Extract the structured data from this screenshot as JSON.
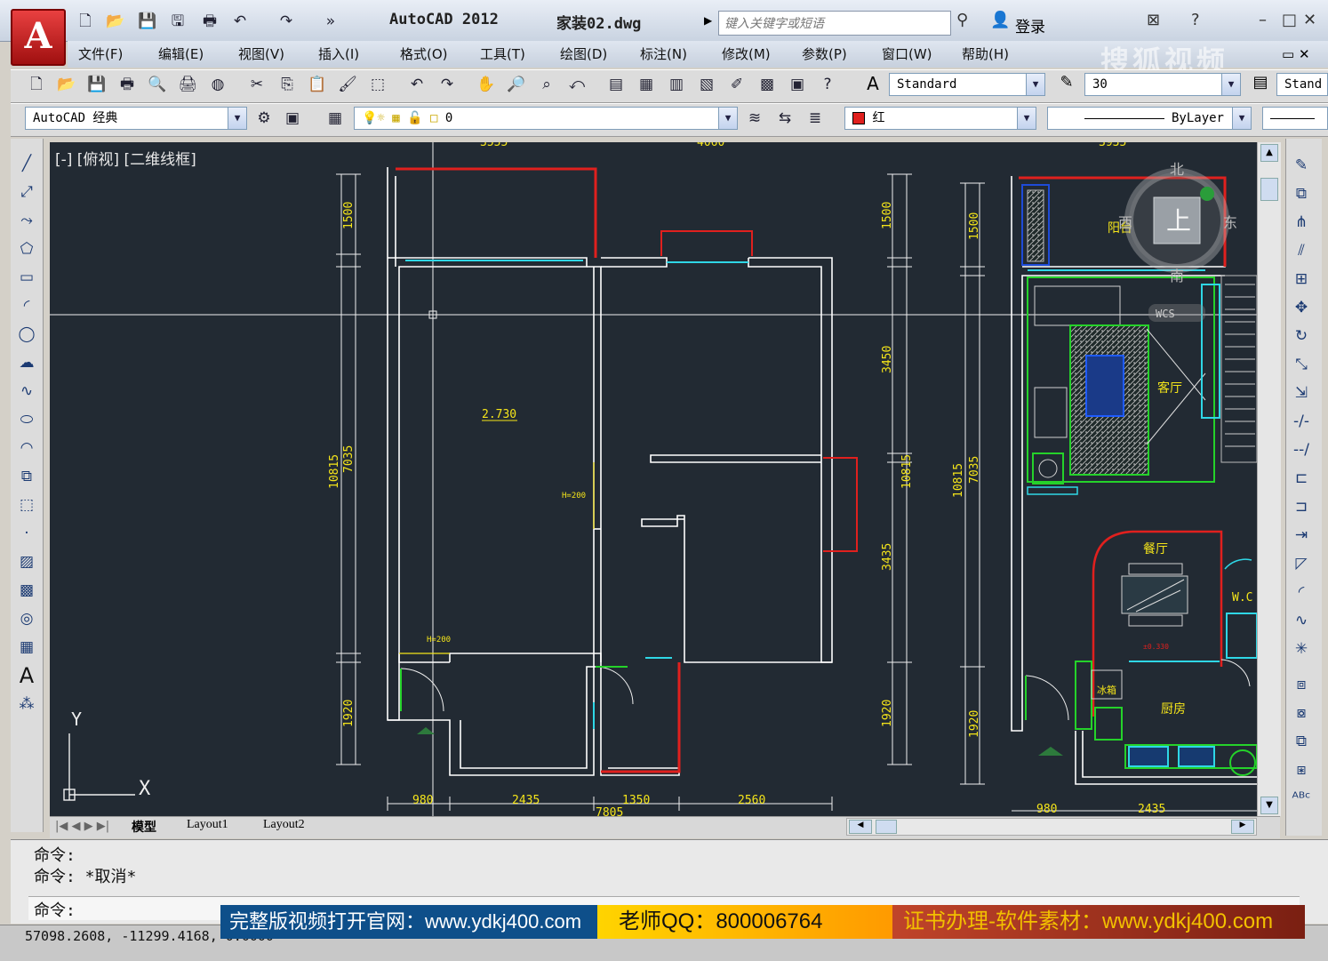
{
  "title_bar": {
    "app_title": "AutoCAD 2012",
    "document_name": "家装02.dwg",
    "search_placeholder": "键入关键字或短语",
    "signin_label": "登录"
  },
  "menu": [
    "文件(F)",
    "编辑(E)",
    "视图(V)",
    "插入(I)",
    "格式(O)",
    "工具(T)",
    "绘图(D)",
    "标注(N)",
    "修改(M)",
    "参数(P)",
    "窗口(W)",
    "帮助(H)"
  ],
  "toolbar": {
    "text_style": "Standard",
    "dim_value": "30",
    "dim_style": "Stand",
    "workspace": "AutoCAD 经典",
    "layer": "0",
    "color": "红",
    "linetype": "ByLayer"
  },
  "viewport": {
    "label": "[-] [俯视] [二维线框]",
    "viewcube_top": "上",
    "viewcube_n": "北",
    "viewcube_s": "南",
    "viewcube_e": "东",
    "viewcube_w": "西",
    "viewcube_wcs": "WCS",
    "ucs_y": "Y",
    "ucs_x": "X"
  },
  "drawing_left": {
    "dims_top": [
      "3555",
      "4060"
    ],
    "dims_vert_left": [
      "1500",
      "7035",
      "10815",
      "1920"
    ],
    "dims_vert_right": [
      "1500",
      "3450",
      "10815",
      "3435",
      "1920"
    ],
    "dims_bottom": [
      "980",
      "2435",
      "1350",
      "2560",
      "7805"
    ],
    "elevation": "2.730",
    "h_labels": [
      "H=200",
      "H=200"
    ]
  },
  "drawing_right": {
    "dims_top": [
      "3935"
    ],
    "dims_vert": [
      "1500",
      "10815",
      "7035",
      "1920"
    ],
    "dims_bottom": [
      "980",
      "2435"
    ],
    "rooms": [
      "阳台",
      "客厅",
      "餐厅",
      "厨房",
      "冰箱",
      "W.C"
    ],
    "elevation": "±0.330"
  },
  "tabs": [
    "模型",
    "Layout1",
    "Layout2"
  ],
  "command": {
    "line1": "命令:",
    "line2": "命令: *取消*",
    "prompt": "命令:"
  },
  "status": {
    "coords": "57098.2608,  -11299.4168,  0.0000"
  },
  "banner": {
    "part1": "完整版视频打开官网：www.ydkj400.com",
    "part2": "老师QQ：800006764",
    "part3": "证书办理-软件素材：www.ydkj400.com"
  },
  "watermark": "搜狐视频",
  "colors": {
    "canvas": "#222a33",
    "wall": "#ffffff",
    "dim": "#f5e51a",
    "red": "#e0201e",
    "cyan": "#2fd7e6",
    "green": "#25d22a"
  }
}
